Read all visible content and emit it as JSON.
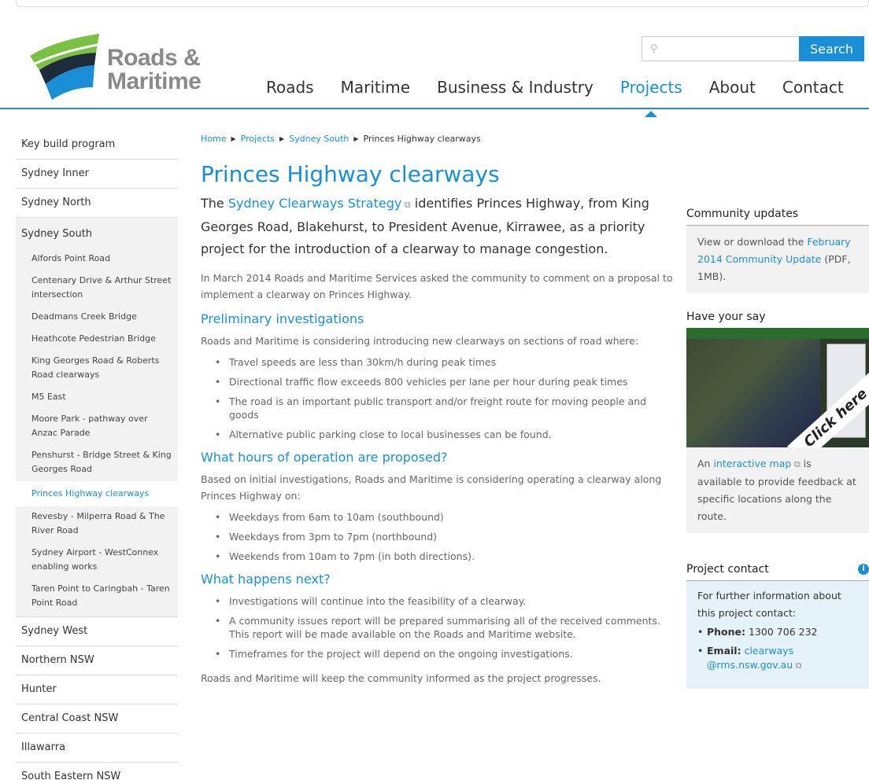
{
  "header": {
    "logo_line1": "Roads &",
    "logo_line2": "Maritime",
    "search_placeholder": "",
    "search_button": "Search",
    "nav": [
      "Roads",
      "Maritime",
      "Business & Industry",
      "Projects",
      "About",
      "Contact"
    ],
    "active_nav": "Projects"
  },
  "sidebar": {
    "top_items": [
      "Key build program",
      "Sydney Inner",
      "Sydney North"
    ],
    "group": "Sydney South",
    "sub_items": [
      "Alfords Point Road",
      "Centenary Drive & Arthur Street intersection",
      "Deadmans Creek Bridge",
      "Heathcote Pedestrian Bridge",
      "King Georges Road & Roberts Road clearways",
      "M5 East",
      "Moore Park - pathway over Anzac Parade",
      "Penshurst - Bridge Street & King Georges Road",
      "Princes Highway clearways",
      "Revesby - Milperra Road & The River Road",
      "Sydney Airport - WestConnex enabling works",
      "Taren Point to Caringbah - Taren Point Road"
    ],
    "active_sub": "Princes Highway clearways",
    "bottom_items": [
      "Sydney West",
      "Northern NSW",
      "Hunter",
      "Central Coast NSW",
      "Illawarra",
      "South Eastern NSW"
    ]
  },
  "breadcrumb": [
    "Home",
    "Projects",
    "Sydney South",
    "Princes Highway clearways"
  ],
  "main": {
    "title": "Princes Highway clearways",
    "intro_pre": "The ",
    "intro_link": "Sydney Clearways Strategy",
    "intro_post": " identifies Princes Highway, from King Georges Road, Blakehurst, to President Avenue, Kirrawee, as a priority project for the introduction of a clearway to manage congestion.",
    "p1": "In March 2014 Roads and Maritime Services asked the community to comment on a proposal to implement a clearway on Princes Highway.",
    "h_prelim": "Preliminary investigations",
    "p_prelim": "Roads and Maritime is considering introducing new clearways on sections of road where:",
    "prelim_bullets": [
      "Travel speeds are less than 30km/h during peak times",
      "Directional traffic flow exceeds 800 vehicles per lane per hour during peak times",
      "The road is an important public transport and/or freight route for moving people and goods",
      "Alternative public parking close to local businesses can be found."
    ],
    "h_hours": "What hours of operation are proposed?",
    "p_hours": "Based on initial investigations, Roads and Maritime is considering operating a clearway along Princes Highway on:",
    "hours_bullets": [
      "Weekdays from 6am to 10am (southbound)",
      "Weekdays from 3pm to 7pm (northbound)",
      "Weekends from 10am to 7pm (in both directions)."
    ],
    "h_next": "What happens next?",
    "next_bullets": [
      "Investigations will continue into the feasibility of a clearway.",
      "A community issues report will be prepared summarising all of the received comments. This report will be made available on the Roads and Maritime website.",
      "Timeframes for the project will depend on the ongoing investigations."
    ],
    "p_final": "Roads and Maritime will keep the community informed as the project progresses."
  },
  "right": {
    "updates_title": "Community updates",
    "updates_pre": "View or download the ",
    "updates_link": "February 2014 Community Update",
    "updates_post": " (PDF, 1MB).",
    "say_title": "Have your say",
    "map_banner": "Click here",
    "say_pre": "An ",
    "say_link": "interactive map",
    "say_post": " is available to provide feedback at specific locations along the route.",
    "contact_title": "Project contact",
    "contact_text": "For further information about this project contact:",
    "phone_label": "Phone:",
    "phone_value": " 1300 706 232",
    "email_label": "Email:",
    "email_value": "clearways @rms.nsw.gov.au"
  },
  "colors": {
    "brand": "#1a8fd8",
    "sidebar_bg": "#f2f2f2",
    "contact_bg": "#e6f2fa"
  }
}
